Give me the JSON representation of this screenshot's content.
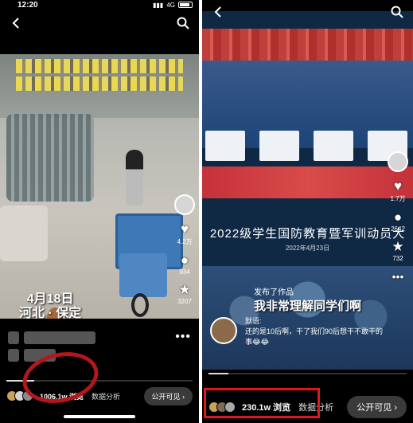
{
  "left": {
    "status_time": "12:20",
    "status_network": "4G",
    "date_stamp_line1": "4月18日",
    "date_stamp_line2": "河北 · 保定",
    "likes": "4.2万",
    "comments": "934",
    "favorites": "3207",
    "views": "1006.1w 浏览",
    "analytics": "数据分析",
    "visibility": "公开可见 ›"
  },
  "right": {
    "stage_text": "2022级学生国防教育暨军训动员大",
    "stage_sub": "2022年4月23日",
    "caption": "我非常理解同学们啊",
    "published": "发布了作品",
    "poster_name": "默语:",
    "post_text": "还的是10后啊，干了我们90后想干不敢干的事😂😂",
    "likes": "1.7万",
    "comments": "2642",
    "favorites": "732",
    "views": "230.1w 浏览",
    "analytics": "数据分析",
    "visibility": "公开可见 ›"
  },
  "icons": {
    "back": "chevron-left-icon",
    "search": "search-icon",
    "like": "heart-icon",
    "comment": "comment-icon",
    "favorite": "star-icon",
    "more": "more-icon"
  },
  "colors": {
    "highlight_red": "#e0161d",
    "circle_red": "#b4161c"
  }
}
